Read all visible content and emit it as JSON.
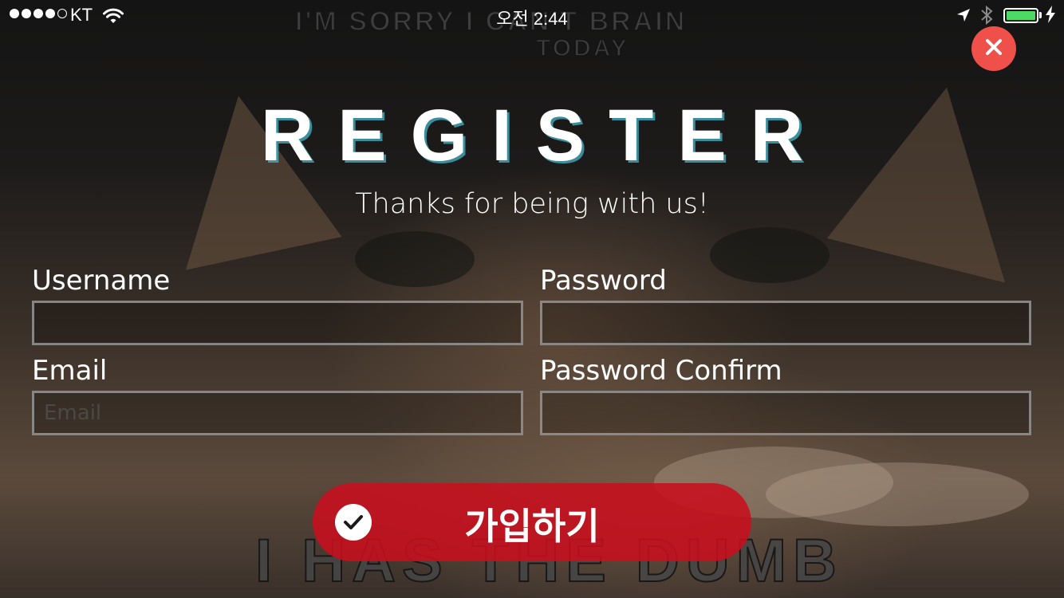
{
  "status_bar": {
    "carrier": "KT",
    "time": "오전 2:44",
    "signal_bars_filled": 4,
    "signal_bars_total": 5,
    "battery_level": 1.0
  },
  "background": {
    "meme_top_line1": "I'M SORRY I CAN'T BRAIN",
    "meme_top_line2": "TODAY",
    "meme_bottom": "I HAS THE DUMB"
  },
  "dialog": {
    "title": "REGISTER",
    "subtitle": "Thanks for being with us!",
    "fields": {
      "username": {
        "label": "Username",
        "value": "",
        "placeholder": ""
      },
      "password": {
        "label": "Password",
        "value": "",
        "placeholder": ""
      },
      "email": {
        "label": "Email",
        "value": "",
        "placeholder": "Email"
      },
      "password_confirm": {
        "label": "Password Confirm",
        "value": "",
        "placeholder": ""
      }
    },
    "submit_label": "가입하기"
  },
  "colors": {
    "accent_red": "#c80f1e",
    "close_red": "#f0504a",
    "battery_green": "#4cd964"
  },
  "icons": {
    "close": "close-icon",
    "submit": "check-circle-icon"
  }
}
